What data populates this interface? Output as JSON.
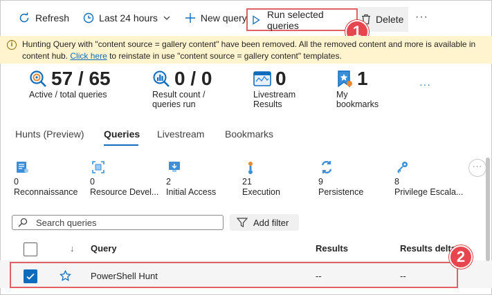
{
  "toolbar": {
    "refresh": "Refresh",
    "time_range": "Last 24 hours",
    "new_query": "New query",
    "run_selected": "Run selected queries",
    "delete": "Delete",
    "more": "···"
  },
  "callouts": {
    "first": "1",
    "second": "2"
  },
  "banner": {
    "icon": "i",
    "text_before": "Hunting Query with \"content source = gallery content\" have been removed. All the removed content and more is available in content hub. ",
    "link": "Click here",
    "text_after": " to reinstate in use \"content source = gallery content\" templates."
  },
  "metrics": [
    {
      "value": "57 / 65",
      "label1": "Active / total queries",
      "label2": ""
    },
    {
      "value": "0 / 0",
      "label1": "Result count /",
      "label2": "queries run"
    },
    {
      "value": "0",
      "label1": "Livestream",
      "label2": "Results"
    },
    {
      "value": "1",
      "label1": "My",
      "label2": "bookmarks"
    }
  ],
  "metrics_more": "···",
  "tabs": [
    "Hunts (Preview)",
    "Queries",
    "Livestream",
    "Bookmarks"
  ],
  "active_tab": "Queries",
  "tactics": [
    {
      "count": "0",
      "name": "Reconnaissance",
      "icon": "reconnaissance-icon",
      "color": "#3b8fd9"
    },
    {
      "count": "0",
      "name": "Resource Devel...",
      "icon": "resource-development-icon",
      "color": "#3b8fd9"
    },
    {
      "count": "2",
      "name": "Initial Access",
      "icon": "initial-access-icon",
      "color": "#3b8fd9"
    },
    {
      "count": "21",
      "name": "Execution",
      "icon": "execution-icon",
      "color": "#e8892d"
    },
    {
      "count": "9",
      "name": "Persistence",
      "icon": "persistence-icon",
      "color": "#3b8fd9"
    },
    {
      "count": "8",
      "name": "Privilege Escala...",
      "icon": "privilege-escalation-icon",
      "color": "#3b8fd9"
    }
  ],
  "tactics_more": "···",
  "search": {
    "placeholder": "Search queries",
    "add_filter": "Add filter"
  },
  "table": {
    "columns": {
      "sort": "↓",
      "query": "Query",
      "results": "Results",
      "results_delta": "Results delta"
    },
    "rows": [
      {
        "query": "PowerShell Hunt",
        "results": "--",
        "results_delta": "--",
        "selected": true
      }
    ]
  },
  "colors": {
    "accent": "#0f6cbd",
    "callout": "#e8464e",
    "banner_bg": "#fff4ce"
  }
}
